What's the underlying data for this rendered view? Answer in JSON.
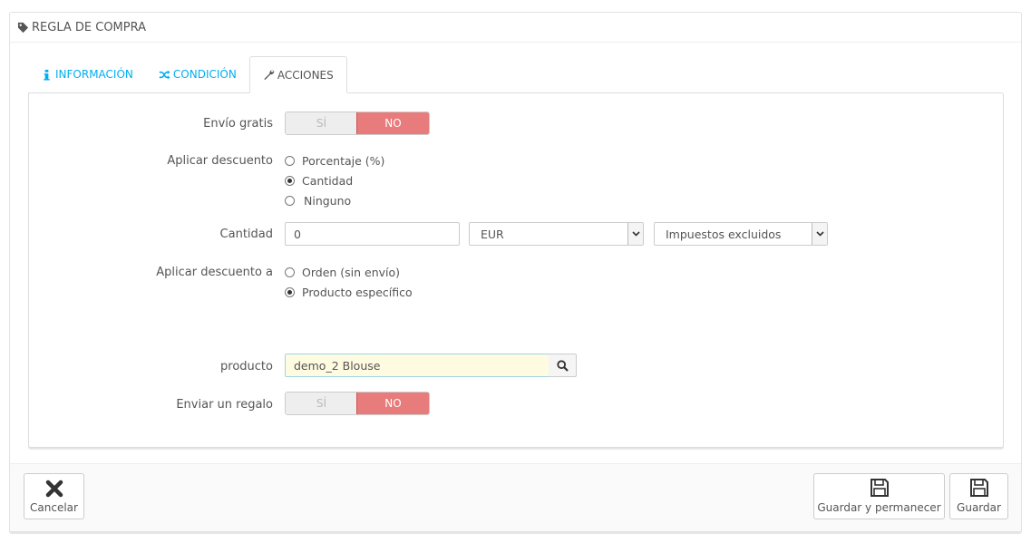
{
  "panel": {
    "title": "Regla de compra",
    "title_icon": "tag-icon"
  },
  "tabs": [
    {
      "label": "Información",
      "icon": "info-icon",
      "active": false
    },
    {
      "label": "Condición",
      "icon": "shuffle-icon",
      "active": false
    },
    {
      "label": "Acciones",
      "icon": "wrench-icon",
      "active": true
    }
  ],
  "form": {
    "free_shipping": {
      "label": "Envío gratis",
      "yes": "SÍ",
      "no": "NO",
      "value": "NO"
    },
    "apply_discount": {
      "label": "Aplicar descuento",
      "options": [
        "Porcentaje (%)",
        "Cantidad",
        "Ninguno"
      ],
      "selected": "Cantidad"
    },
    "amount": {
      "label": "Cantidad",
      "value": "0",
      "currency": "EUR",
      "tax": "Impuestos excluidos"
    },
    "apply_to": {
      "label": "Aplicar descuento a",
      "options": [
        "Orden (sin envío)",
        "Producto específico"
      ],
      "selected": "Producto específico"
    },
    "product": {
      "label": "producto",
      "value": "demo_2 Blouse"
    },
    "gift": {
      "label": "Enviar un regalo",
      "yes": "SÍ",
      "no": "NO",
      "value": "NO"
    }
  },
  "footer": {
    "cancel": "Cancelar",
    "save_stay": "Guardar y permanecer",
    "save": "Guardar"
  },
  "colors": {
    "accent": "#00aff0",
    "no_active": "#e87b7b"
  }
}
